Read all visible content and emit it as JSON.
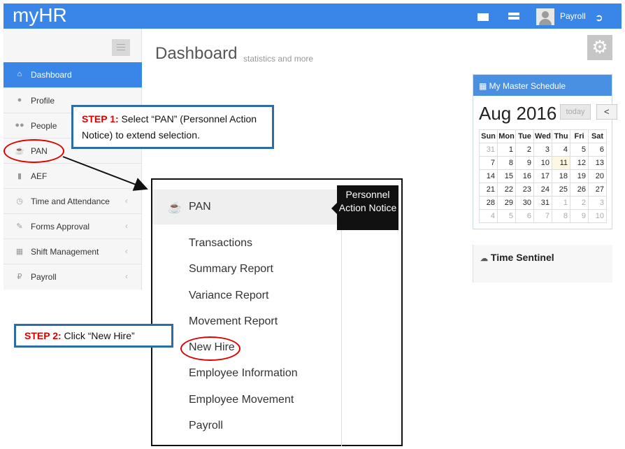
{
  "app": {
    "title": "myHR"
  },
  "header": {
    "user_name": "Payroll"
  },
  "sidebar": {
    "items": [
      {
        "label": "Dashboard",
        "icon": "home-icon"
      },
      {
        "label": "Profile",
        "icon": "user-icon"
      },
      {
        "label": "People",
        "icon": "users-icon"
      },
      {
        "label": "PAN",
        "icon": "trophy-icon"
      },
      {
        "label": "AEF",
        "icon": "folder-icon"
      },
      {
        "label": "Time and Attendance",
        "icon": "clock-icon"
      },
      {
        "label": "Forms Approval",
        "icon": "pencil-icon"
      },
      {
        "label": "Shift Management",
        "icon": "calendar-icon"
      },
      {
        "label": "Payroll",
        "icon": "ruble-icon"
      }
    ],
    "active_index": 0
  },
  "main": {
    "title": "Dashboard",
    "subtitle": "statistics and more"
  },
  "schedule": {
    "heading": "My Master Schedule",
    "month_title": "Aug 2016",
    "today_label": "today",
    "prev_label": "<",
    "weekdays": [
      "Sun",
      "Mon",
      "Tue",
      "Wed",
      "Thu",
      "Fri",
      "Sat"
    ],
    "weeks": [
      [
        "31",
        "1",
        "2",
        "3",
        "4",
        "5",
        "6"
      ],
      [
        "7",
        "8",
        "9",
        "10",
        "11",
        "12",
        "13"
      ],
      [
        "14",
        "15",
        "16",
        "17",
        "18",
        "19",
        "20"
      ],
      [
        "21",
        "22",
        "23",
        "24",
        "25",
        "26",
        "27"
      ],
      [
        "28",
        "29",
        "30",
        "31",
        "1",
        "2",
        "3"
      ],
      [
        "4",
        "5",
        "6",
        "7",
        "8",
        "9",
        "10"
      ]
    ],
    "today": "11"
  },
  "time_sentinel": {
    "title": "Time Sentinel"
  },
  "steps": {
    "step1_key": "STEP 1:",
    "step1_text": " Select “PAN” (Personnel Action Notice) to extend selection.",
    "step2_key": "STEP 2:",
    "step2_text": " Click “New Hire”"
  },
  "zoom": {
    "menu_label": "PAN",
    "tooltip": "Personnel Action Notice",
    "items": [
      "Transactions",
      "Summary Report",
      "Variance Report",
      "Movement Report",
      "New Hire",
      "Employee Information",
      "Employee Movement",
      "Payroll"
    ]
  },
  "colors": {
    "brand": "#3a86e8",
    "callout_border": "#2e6da4",
    "highlight": "#e00000"
  }
}
